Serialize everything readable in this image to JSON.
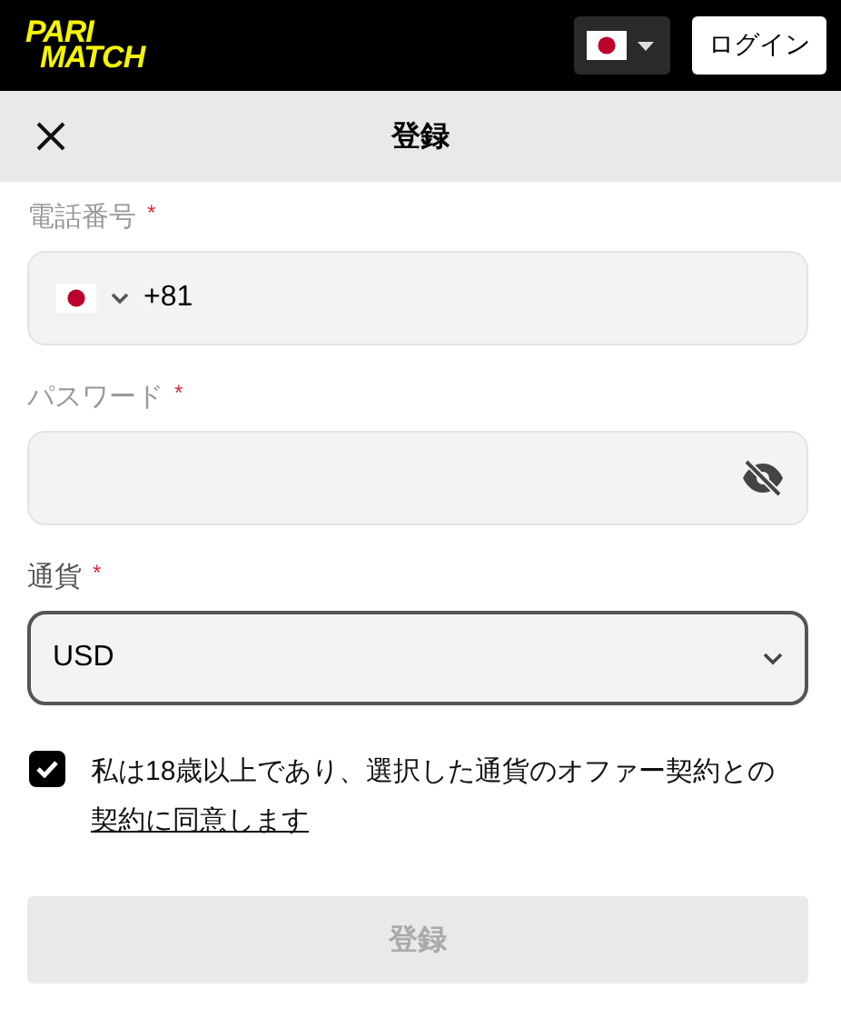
{
  "header": {
    "logo": [
      "PARI",
      "MATCH"
    ],
    "login_button": "ログイン"
  },
  "title_bar": {
    "title": "登録"
  },
  "fields": [
    {
      "kind": "phone",
      "label": "電話番号",
      "required_mark": "*",
      "value": "+81",
      "focused": false
    },
    {
      "kind": "password",
      "label": "パスワード",
      "required_mark": "*",
      "masked": true,
      "focused": false
    },
    {
      "kind": "select",
      "label": "通貨",
      "required_mark": "*",
      "value": "USD",
      "focused": true
    }
  ],
  "agreement": {
    "checked": true,
    "text": "私は18歳以上であり、選択した通貨のオファー契約との",
    "link": "契約に同意します"
  },
  "submit": {
    "label": "登録",
    "disabled": true
  }
}
